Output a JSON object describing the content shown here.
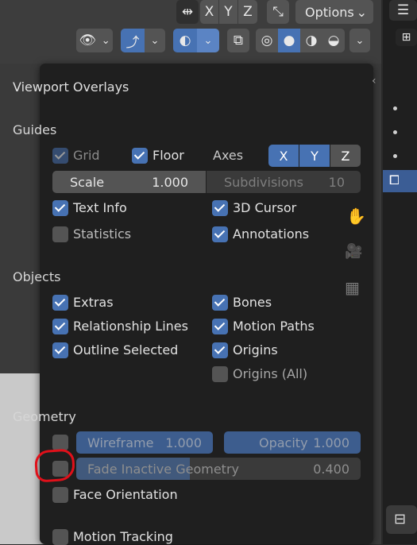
{
  "header": {
    "axis_buttons": [
      "X",
      "Y",
      "Z"
    ],
    "options_label": "Options"
  },
  "popover": {
    "title": "Viewport Overlays",
    "guides": {
      "heading": "Guides",
      "grid": "Grid",
      "floor": "Floor",
      "axes": "Axes",
      "axes_buttons": [
        "X",
        "Y",
        "Z"
      ],
      "scale_label": "Scale",
      "scale_value": "1.000",
      "subdivisions_label": "Subdivisions",
      "subdivisions_value": "10",
      "text_info": "Text Info",
      "cursor_3d": "3D Cursor",
      "statistics": "Statistics",
      "annotations": "Annotations"
    },
    "objects": {
      "heading": "Objects",
      "extras": "Extras",
      "bones": "Bones",
      "relationship_lines": "Relationship Lines",
      "motion_paths": "Motion Paths",
      "outline_selected": "Outline Selected",
      "origins": "Origins",
      "origins_all": "Origins (All)"
    },
    "geometry": {
      "heading": "Geometry",
      "wireframe_label": "Wireframe",
      "wireframe_value": "1.000",
      "opacity_label": "Opacity",
      "opacity_value": "1.000",
      "fade_inactive_label": "Fade Inactive Geometry",
      "fade_inactive_value": "0.400",
      "fade_inactive_fraction": 0.4,
      "face_orientation": "Face Orientation"
    },
    "motion_tracking": "Motion Tracking"
  },
  "colors": {
    "accent": "#4772b3",
    "panel_bg": "#1f1f1f",
    "highlight_annotation": "#e0101a"
  }
}
